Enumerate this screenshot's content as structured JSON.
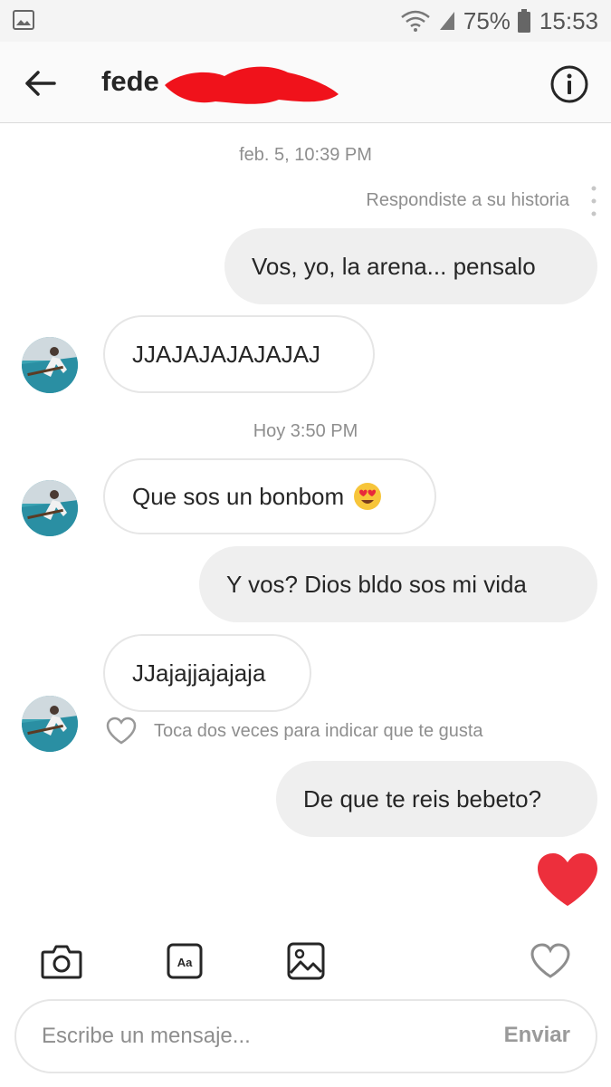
{
  "status_bar": {
    "battery_percent": "75%",
    "time": "15:53",
    "icons": [
      "gallery-icon",
      "wifi-icon",
      "signal-icon",
      "battery-icon"
    ]
  },
  "header": {
    "username_visible": "fede",
    "back_icon": "arrow-left-icon",
    "info_icon": "info-icon"
  },
  "chat": {
    "timestamp_1": "feb. 5, 10:39 PM",
    "reply_note": "Respondiste a su historia",
    "msg_out_1": "Vos, yo, la arena... pensalo",
    "msg_in_1": "JJAJAJAJAJAJAJ",
    "timestamp_2": "Hoy 3:50 PM",
    "msg_in_2": "Que sos un bonbom",
    "msg_in_2_emoji": "heart-eyes-emoji",
    "msg_out_2": "Y vos? Dios bldo sos mi vida",
    "msg_in_3": "JJajajjajajaja",
    "like_hint": "Toca dos veces para indicar que te gusta",
    "msg_out_3": "De que te reis bebeto?",
    "sent_heart_color": "#ed2f3c"
  },
  "toolbar": {
    "icons": [
      "camera-icon",
      "text-aa-icon",
      "image-icon",
      "heart-outline-icon"
    ]
  },
  "composer": {
    "placeholder": "Escribe un mensaje...",
    "send_label": "Enviar"
  }
}
